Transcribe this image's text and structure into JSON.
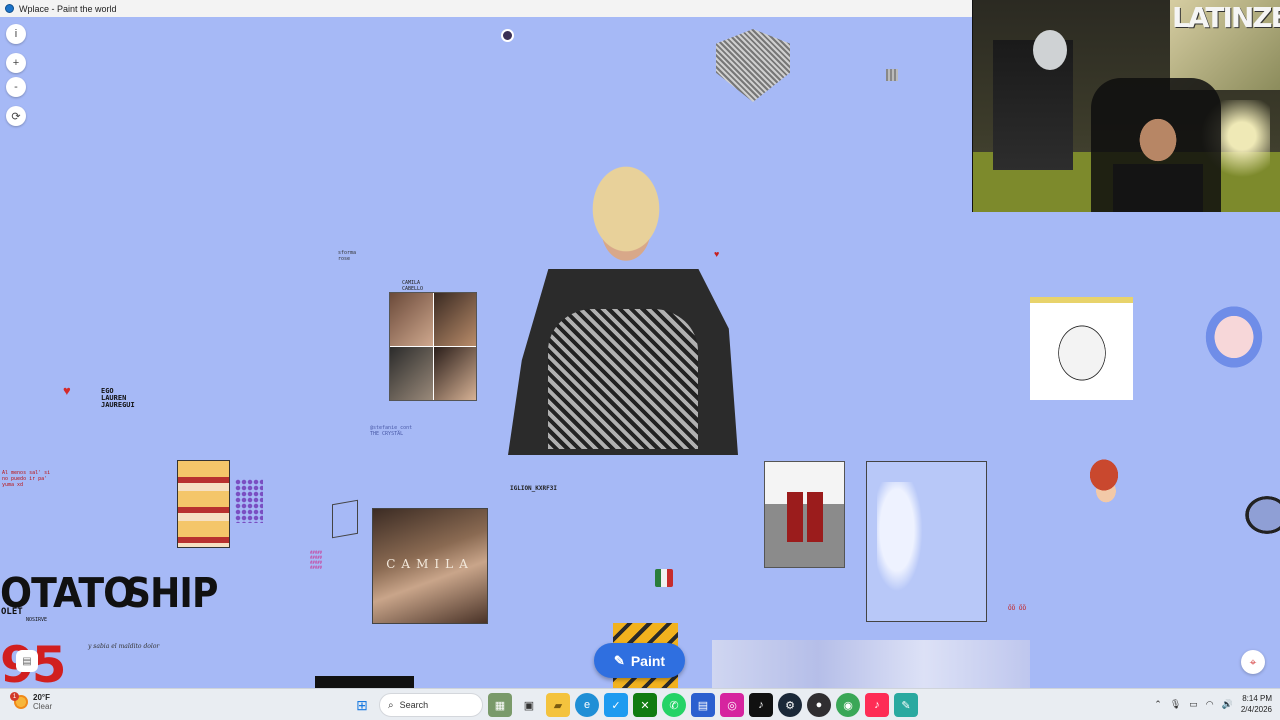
{
  "window": {
    "title": "Wplace - Paint the world"
  },
  "map_controls": {
    "info_label": "i",
    "zoom_in_label": "+",
    "zoom_out_label": "-",
    "refresh_label": "⟳"
  },
  "canvas_text": {
    "potato": "OTATO",
    "ship": "SHIP",
    "big_red": "95",
    "ego": "EGO\nLAUREN\nJAUREGUI",
    "olet": "OLET",
    "nosirve": "NOSIRVE",
    "album": "CAMILA",
    "collage_caption": "CAMILA\nCABELLO",
    "pink_lines": "#####\n#####\n#####\n#####",
    "red_small": "ÖÖ ÖÖ",
    "cursive": "y sabia el maldito dolor",
    "spanish_note": "Al menos sal' si\nno puedo ir pa'\nyuma xd",
    "tiny_caption": "IGLION_KXRF3I",
    "small_note": "@stefanie_cont\nTHE CRYSTAL",
    "small_note2": "sforma\nrose"
  },
  "paint_button": {
    "label": "Paint",
    "icon": "pencil-icon"
  },
  "gps_button": {
    "icon": "locate-icon"
  },
  "webcam": {
    "graffiti": "LATINZEL"
  },
  "taskbar": {
    "weather_temp": "20°F",
    "weather_desc": "Clear",
    "weather_badge": "1",
    "search_label": "Search",
    "time": "8:14 PM",
    "date": "2/4/2026",
    "apps": [
      "start-icon",
      "search-icon",
      "widgets-icon",
      "task-view-icon",
      "file-explorer-icon",
      "edge-icon",
      "twitter-icon",
      "xbox-icon",
      "whatsapp-icon",
      "store-icon",
      "instagram-icon",
      "tiktok-icon",
      "steam-icon",
      "obs-icon",
      "chrome-icon",
      "tiktok-live-icon",
      "wplace-icon"
    ]
  },
  "colors": {
    "canvas_bg": "#a6b9f6",
    "paint_button": "#2f6fe0",
    "taskbar_bg": "#e9edf2"
  }
}
